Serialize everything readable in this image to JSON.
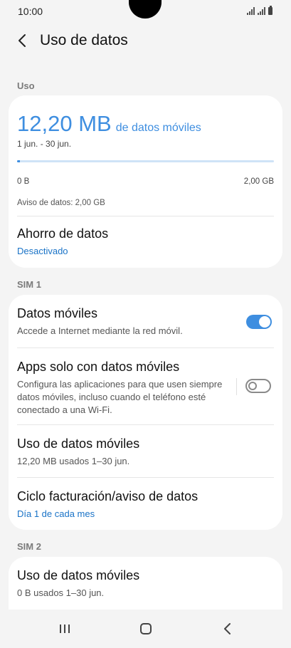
{
  "status_bar": {
    "time": "10:00"
  },
  "app_bar": {
    "title": "Uso de datos"
  },
  "uso": {
    "section_label": "Uso",
    "amount": "12,20 MB",
    "amount_suffix": "de datos móviles",
    "period": "1 jun. - 30 jun.",
    "progress_fraction": 0.006,
    "axis_min": "0 B",
    "axis_max": "2,00 GB",
    "warning": "Aviso de datos: 2,00 GB",
    "saver_title": "Ahorro de datos",
    "saver_status": "Desactivado"
  },
  "sim1": {
    "section_label": "SIM 1",
    "mobile_data_title": "Datos móviles",
    "mobile_data_sub": "Accede a Internet mediante la red móvil.",
    "mobile_data_on": true,
    "apps_only_title": "Apps solo con datos móviles",
    "apps_only_sub": "Configura las aplicaciones para que usen siempre datos móviles, incluso cuando el teléfono esté conectado a una Wi-Fi.",
    "apps_only_on": false,
    "usage_title": "Uso de datos móviles",
    "usage_sub": "12,20 MB usados 1–30 jun.",
    "billing_title": "Ciclo facturación/aviso de datos",
    "billing_sub": "Día 1 de cada mes"
  },
  "sim2": {
    "section_label": "SIM 2",
    "usage_title": "Uso de datos móviles",
    "usage_sub": "0 B usados 1–30 jun."
  },
  "colors": {
    "accent": "#3e8ee0",
    "link": "#1a73c7",
    "background": "#f4f4f4"
  },
  "icons": {
    "back": "chevron-left-icon",
    "recents": "recent-apps-icon",
    "home": "home-icon",
    "nav_back": "nav-back-icon"
  }
}
